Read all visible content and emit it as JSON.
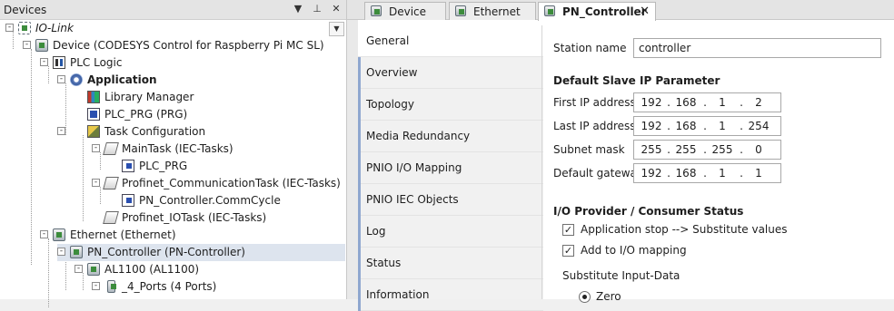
{
  "devices_pane": {
    "title": "Devices",
    "controls": {
      "dropdown": "▼",
      "pin": "⊥",
      "close": "✕"
    }
  },
  "tree": [
    {
      "label": "IO-Link",
      "style": "italic",
      "icon": "project-icon",
      "expander": "-"
    },
    {
      "label": "Device (CODESYS Control for Raspberry Pi MC SL)",
      "icon": "device-icon",
      "expander": "-"
    },
    {
      "label": "PLC Logic",
      "icon": "plc-logic-icon",
      "expander": "-"
    },
    {
      "label": "Application",
      "style": "bold",
      "icon": "gear-icon",
      "expander": "-"
    },
    {
      "label": "Library Manager",
      "icon": "library-icon"
    },
    {
      "label": "PLC_PRG (PRG)",
      "icon": "program-icon"
    },
    {
      "label": "Task Configuration",
      "icon": "task-config-icon",
      "expander": "-"
    },
    {
      "label": "MainTask (IEC-Tasks)",
      "icon": "task-icon",
      "expander": "-"
    },
    {
      "label": "PLC_PRG",
      "icon": "program-call-icon"
    },
    {
      "label": "Profinet_CommunicationTask (IEC-Tasks)",
      "icon": "task-icon",
      "expander": "-"
    },
    {
      "label": "PN_Controller.CommCycle",
      "icon": "program-call-icon"
    },
    {
      "label": "Profinet_IOTask (IEC-Tasks)",
      "icon": "task-icon"
    },
    {
      "label": "Ethernet (Ethernet)",
      "icon": "ethernet-device-icon",
      "expander": "-"
    },
    {
      "label": "PN_Controller (PN-Controller)",
      "icon": "pn-controller-icon",
      "expander": "-"
    },
    {
      "label": "AL1100 (AL1100)",
      "icon": "io-device-icon",
      "expander": "-"
    },
    {
      "label": "_4_Ports (4 Ports)",
      "icon": "module-icon",
      "expander": "-"
    }
  ],
  "editor_tabs": [
    {
      "label": "Device",
      "icon": "device-icon"
    },
    {
      "label": "Ethernet",
      "icon": "device-icon"
    },
    {
      "label": "PN_Controller",
      "icon": "device-icon",
      "active": true,
      "close": "✕"
    }
  ],
  "side_tabs": [
    {
      "label": "General",
      "active": true
    },
    {
      "label": "Overview"
    },
    {
      "label": "Topology"
    },
    {
      "label": "Media Redundancy"
    },
    {
      "label": "PNIO I/O Mapping"
    },
    {
      "label": "PNIO IEC Objects"
    },
    {
      "label": "Log"
    },
    {
      "label": "Status"
    },
    {
      "label": "Information"
    }
  ],
  "general": {
    "station_name_label": "Station name",
    "station_name_value": "controller",
    "default_slave_ip_title": "Default Slave IP Parameter",
    "ip_rows": [
      {
        "label": "First IP address",
        "octets": [
          "192",
          "168",
          "1",
          "2"
        ]
      },
      {
        "label": "Last IP address",
        "octets": [
          "192",
          "168",
          "1",
          "254"
        ]
      },
      {
        "label": "Subnet mask",
        "octets": [
          "255",
          "255",
          "255",
          "0"
        ]
      },
      {
        "label": "Default gateway",
        "octets": [
          "192",
          "168",
          "1",
          "1"
        ]
      }
    ],
    "io_status_title": "I/O Provider / Consumer Status",
    "checkboxes": [
      {
        "label": "Application stop --> Substitute values",
        "checked": "✓"
      },
      {
        "label": "Add to I/O mapping",
        "checked": "✓"
      }
    ],
    "substitute_label": "Substitute Input-Data",
    "radio_zero_label": "Zero"
  }
}
